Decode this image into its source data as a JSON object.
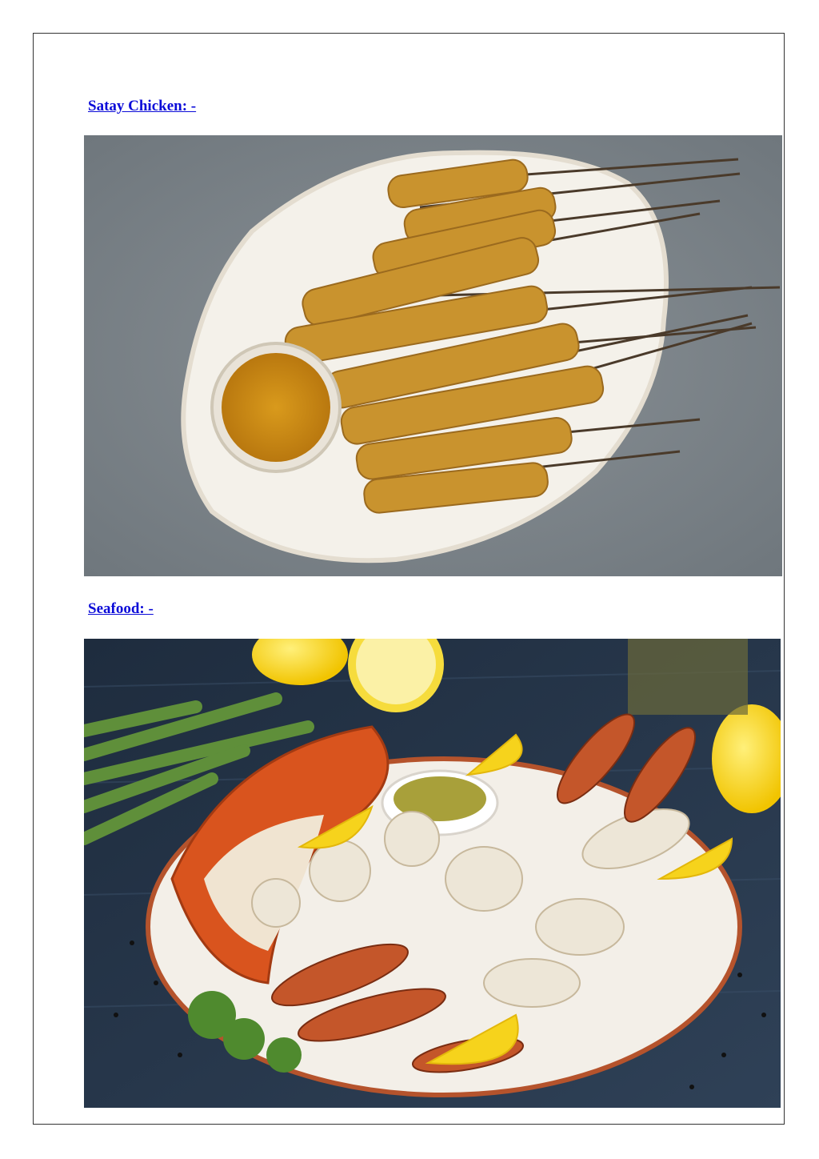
{
  "sections": [
    {
      "heading": "Satay Chicken: -",
      "image_subject": "satay chicken skewers on a white platter with peanut dipping sauce"
    },
    {
      "heading": "Seafood: -",
      "image_subject": "grilled seafood platter with lobster, prawns, squid, scallops and lemon"
    }
  ],
  "colors": {
    "link": "#0b0bd8",
    "border": "#333333"
  }
}
